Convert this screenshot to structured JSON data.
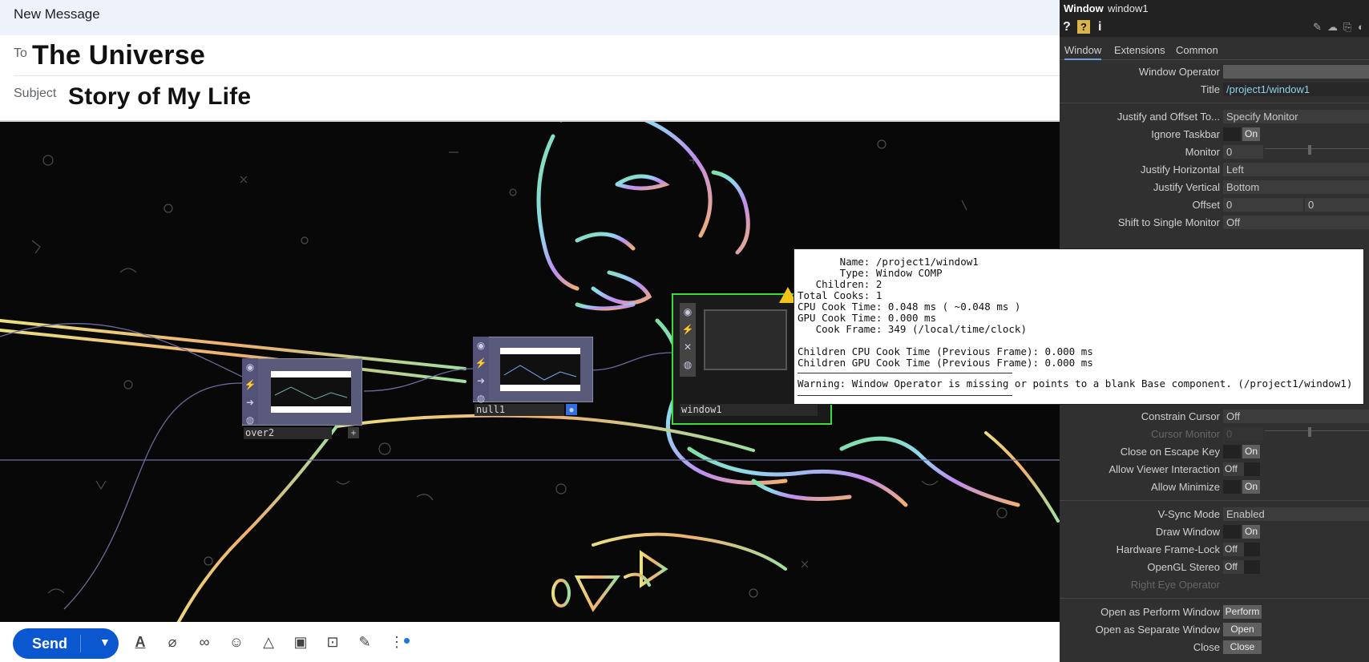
{
  "compose": {
    "title": "New Message",
    "to_label": "To",
    "to_value": "The Universe",
    "subject_label": "Subject",
    "subject_value": "Story of My Life",
    "send_label": "Send"
  },
  "nodes": {
    "over2": "over2",
    "null1": "null1",
    "window1": "window1"
  },
  "panel": {
    "op_type": "Window",
    "op_name": "window1",
    "tabs": [
      "Window",
      "Extensions",
      "Common"
    ],
    "params": {
      "window_operator": "Window Operator",
      "title_label": "Title",
      "title_value": "/project1/window1",
      "justify_offset_label": "Justify and Offset To...",
      "justify_offset_value": "Specify Monitor",
      "ignore_taskbar_label": "Ignore Taskbar",
      "monitor_label": "Monitor",
      "monitor_value": "0",
      "justify_h_label": "Justify Horizontal",
      "justify_h_value": "Left",
      "justify_v_label": "Justify Vertical",
      "justify_v_value": "Bottom",
      "offset_label": "Offset",
      "offset_x": "0",
      "offset_y": "0",
      "shift_label": "Shift to Single Monitor",
      "shift_value": "Off",
      "constrain_label": "Constrain Cursor",
      "constrain_value": "Off",
      "cursor_monitor_label": "Cursor Monitor",
      "cursor_monitor_value": "0",
      "close_escape_label": "Close on Escape Key",
      "allow_viewer_label": "Allow Viewer Interaction",
      "allow_minimize_label": "Allow Minimize",
      "vsync_label": "V-Sync Mode",
      "vsync_value": "Enabled",
      "draw_window_label": "Draw Window",
      "hw_framelock_label": "Hardware Frame-Lock",
      "opengl_stereo_label": "OpenGL Stereo",
      "right_eye_label": "Right Eye Operator",
      "perform_label": "Open as Perform Window",
      "perform_btn": "Perform",
      "separate_label": "Open as Separate Window",
      "separate_btn": "Open",
      "close_label": "Close",
      "close_btn": "Close",
      "on": "On",
      "off": "Off"
    }
  },
  "info": {
    "lines": [
      "       Name: /project1/window1",
      "       Type: Window COMP",
      "   Children: 2",
      "Total Cooks: 1",
      "CPU Cook Time: 0.048 ms ( ~0.048 ms )",
      "GPU Cook Time: 0.000 ms",
      "   Cook Frame: 349 (/local/time/clock)",
      "Children CPU Cook Time (Previous Frame): 0.000 ms",
      "Children GPU Cook Time (Previous Frame): 0.000 ms",
      "Warning: Window Operator is missing or points to a blank Base component. (/project1/window1)"
    ]
  },
  "colors": {
    "send": "#0b57d0",
    "accent_title": "#8fd0e8",
    "node_selected": "#3cdc3c"
  }
}
